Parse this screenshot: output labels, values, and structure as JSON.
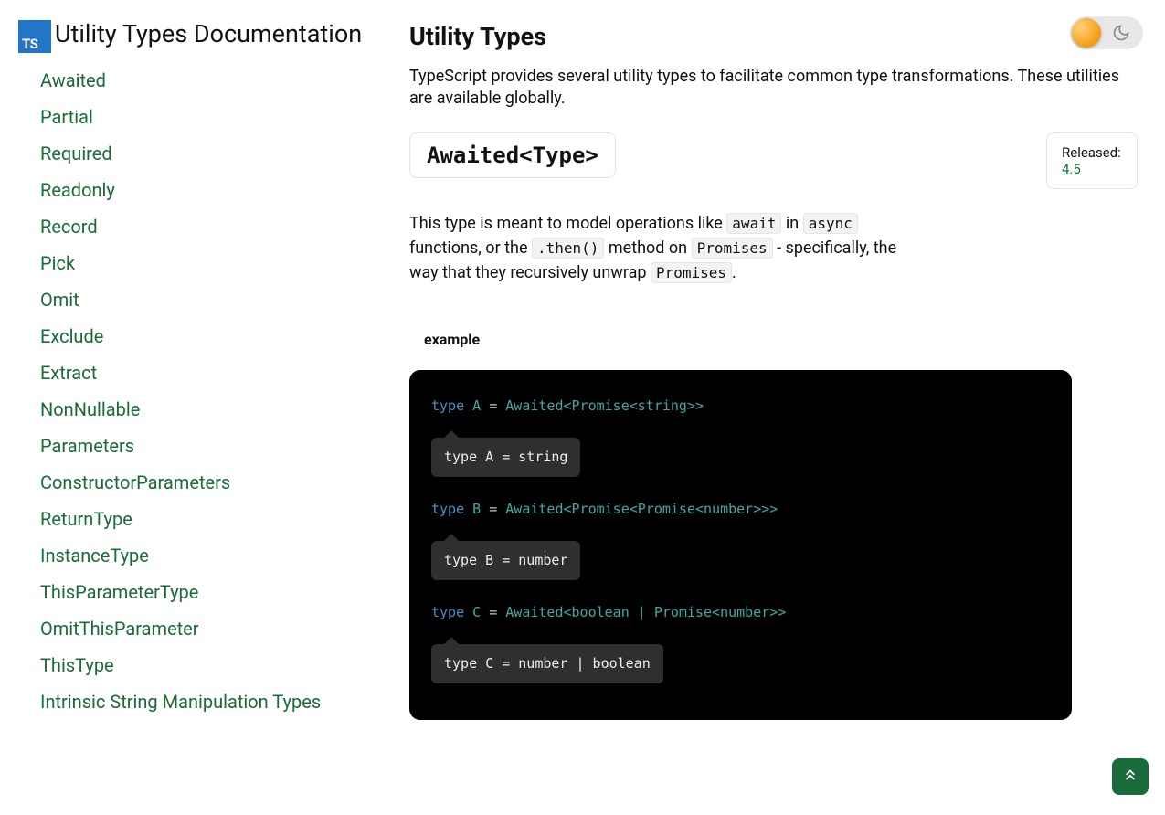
{
  "sidebar": {
    "title": "Utility Types Documentation",
    "logo_text": "TS",
    "items": [
      "Awaited",
      "Partial",
      "Required",
      "Readonly",
      "Record",
      "Pick",
      "Omit",
      "Exclude",
      "Extract",
      "NonNullable",
      "Parameters",
      "ConstructorParameters",
      "ReturnType",
      "InstanceType",
      "ThisParameterType",
      "OmitThisParameter",
      "ThisType",
      "Intrinsic String Manipulation Types"
    ]
  },
  "main": {
    "title": "Utility Types",
    "intro": "TypeScript provides several utility types to facilitate common type transformations. These utilities are available globally.",
    "section": {
      "heading": "Awaited<Type>",
      "released_label": "Released:",
      "released_version": "4.5",
      "body_parts": {
        "t1": "This type is meant to model operations like ",
        "c1": "await",
        "t2": " in ",
        "c2": "async",
        "t3": " functions, or the ",
        "c3": ".then()",
        "t4": " method on ",
        "c4": "Promises",
        "t5": " - specifically, the way that they recursively unwrap ",
        "c5": "Promises",
        "t6": "."
      },
      "example_label": "example",
      "code": {
        "lineA": {
          "kw": "type",
          "name": "A",
          "eq": "=",
          "rhs": "Awaited<Promise<string>>"
        },
        "tipA": "type A = string",
        "lineB": {
          "kw": "type",
          "name": "B",
          "eq": "=",
          "rhs": "Awaited<Promise<Promise<number>>>"
        },
        "tipB": "type B = number",
        "lineC": {
          "kw": "type",
          "name": "C",
          "eq": "=",
          "rhs": "Awaited<boolean | Promise<number>>"
        },
        "tipC": "type C = number | boolean"
      }
    }
  }
}
